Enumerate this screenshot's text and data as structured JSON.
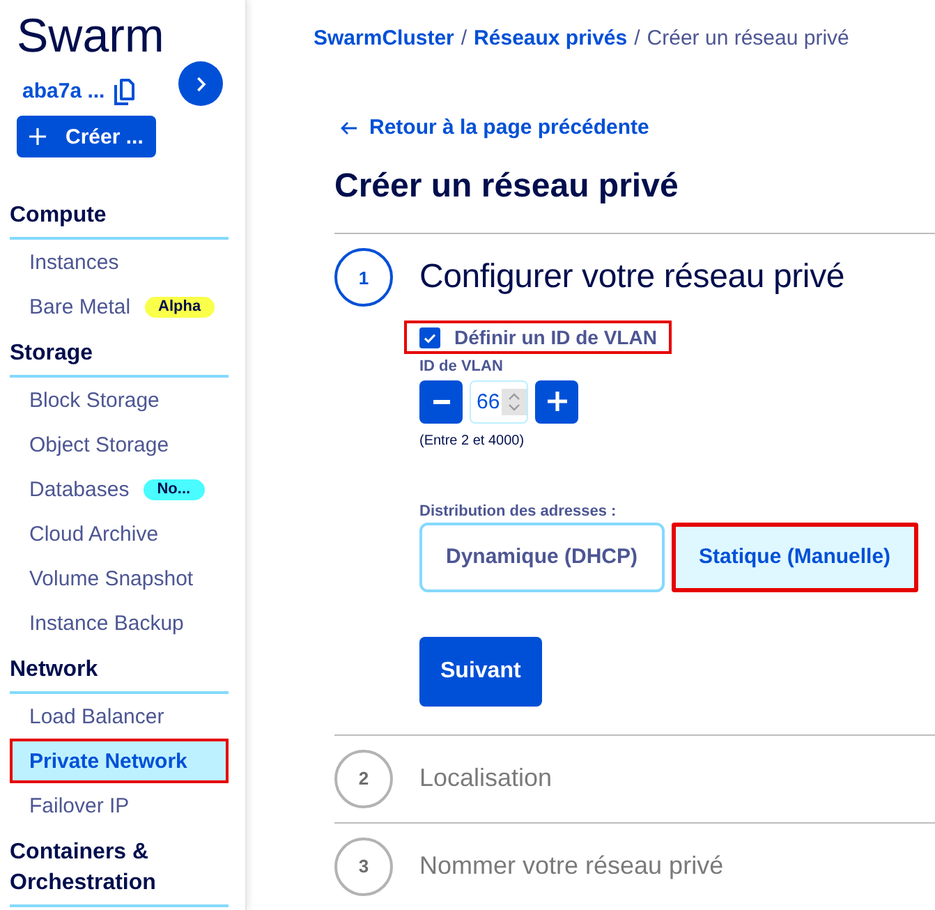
{
  "sidebar": {
    "title": "Swarm",
    "project_id": "aba7a ...",
    "create_button": "Créer ...",
    "sections": [
      {
        "title": "Compute",
        "items": [
          {
            "label": "Instances",
            "selected": false,
            "highlighted": false
          },
          {
            "label": "Bare Metal",
            "selected": false,
            "highlighted": false,
            "badge": {
              "text": "Alpha",
              "color": "#faff4a"
            }
          }
        ]
      },
      {
        "title": "Storage",
        "items": [
          {
            "label": "Block Storage",
            "selected": false,
            "highlighted": false
          },
          {
            "label": "Object Storage",
            "selected": false,
            "highlighted": false
          },
          {
            "label": "Databases",
            "selected": false,
            "highlighted": false,
            "badge": {
              "text": "No...",
              "color": "#4afcff"
            }
          },
          {
            "label": "Cloud Archive",
            "selected": false,
            "highlighted": false
          },
          {
            "label": "Volume Snapshot",
            "selected": false,
            "highlighted": false
          },
          {
            "label": "Instance Backup",
            "selected": false,
            "highlighted": false
          }
        ]
      },
      {
        "title": "Network",
        "items": [
          {
            "label": "Load Balancer",
            "selected": false,
            "highlighted": false
          },
          {
            "label": "Private Network",
            "selected": true,
            "highlighted": true
          },
          {
            "label": "Failover IP",
            "selected": false,
            "highlighted": false
          }
        ]
      },
      {
        "title": "Containers & Orchestration"
      }
    ]
  },
  "breadcrumb": [
    {
      "label": "SwarmCluster",
      "link": true,
      "separator": "/"
    },
    {
      "label": "Réseaux privés",
      "link": true,
      "separator": "/"
    },
    {
      "label": "Créer un réseau privé",
      "link": false
    }
  ],
  "back_link": "Retour à la page précédente",
  "page_title": "Créer un réseau privé",
  "steps": [
    {
      "number": "1",
      "title": "Configurer votre réseau privé",
      "active": true,
      "form": {
        "vlan_checkbox": {
          "label": "Définir un ID de VLAN",
          "checked": true,
          "highlighted": true
        },
        "vlan_id": {
          "label": "ID de VLAN",
          "value": "66",
          "hint": "(Entre 2 et 4000)"
        },
        "distribution": {
          "label": "Distribution des adresses :",
          "options": [
            {
              "label": "Dynamique (DHCP)",
              "selected": false,
              "highlighted": false
            },
            {
              "label": "Statique (Manuelle)",
              "selected": true,
              "highlighted": true
            }
          ]
        },
        "next_button": "Suivant"
      }
    },
    {
      "number": "2",
      "title": "Localisation",
      "active": false
    },
    {
      "number": "3",
      "title": "Nommer votre réseau privé",
      "active": false
    }
  ]
}
